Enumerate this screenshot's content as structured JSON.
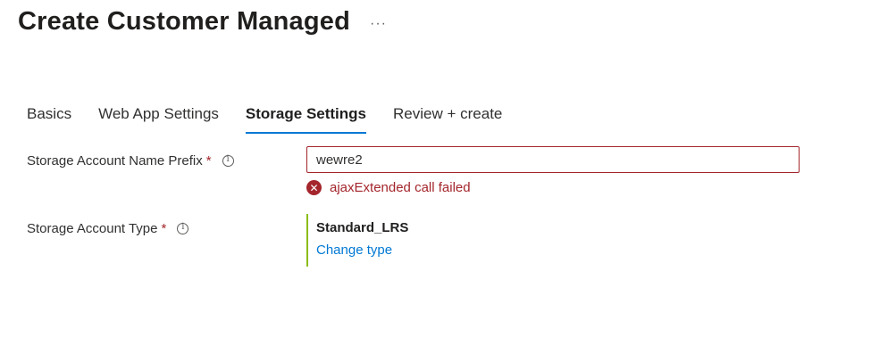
{
  "header": {
    "title": "Create Customer Managed",
    "more_label": "···"
  },
  "tabs": [
    {
      "label": "Basics",
      "active": false
    },
    {
      "label": "Web App Settings",
      "active": false
    },
    {
      "label": "Storage Settings",
      "active": true
    },
    {
      "label": "Review + create",
      "active": false
    }
  ],
  "form": {
    "prefix": {
      "label": "Storage Account Name Prefix",
      "required_mark": "*",
      "value": "wewre2",
      "error_message": "ajaxExtended call failed"
    },
    "account_type": {
      "label": "Storage Account Type",
      "required_mark": "*",
      "selected_type": "Standard_LRS",
      "change_link": "Change type"
    }
  },
  "colors": {
    "accent": "#0078d4",
    "error": "#a4262c",
    "type_bar": "#8cbd18"
  }
}
